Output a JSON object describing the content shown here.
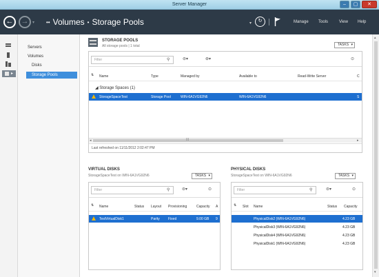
{
  "window": {
    "title": "Server Manager",
    "min": "‒",
    "max": "▢",
    "close": "✕"
  },
  "header": {
    "crumb_arrows": "••",
    "crumb_parent": "Volumes",
    "crumb_sep": "•",
    "crumb_current": "Storage Pools",
    "menu": [
      "Manage",
      "Tools",
      "View",
      "Help"
    ]
  },
  "nav": {
    "items": [
      "Servers",
      "Volumes",
      "Disks",
      "Storage Pools"
    ]
  },
  "storage_pools": {
    "title": "STORAGE POOLS",
    "subtitle": "All storage pools | 1 total",
    "tasks": "TASKS",
    "filter_placeholder": "Filter",
    "columns": [
      "Name",
      "Type",
      "Managed by",
      "Available to",
      "Read-Write Server",
      "C"
    ],
    "group": "Storage Spaces (1)",
    "rows": [
      {
        "name": "StorageSpaceTest",
        "type": "Storage Pool",
        "managed_by": "WIN-6A1VG92N6",
        "available_to": "WIN-6A1VG92N6",
        "rw_server": "",
        "c": "S"
      }
    ],
    "footer": "Last refreshed on 11/11/2012 2:02:47 PM"
  },
  "virtual_disks": {
    "title": "VIRTUAL DISKS",
    "subtitle": "StorageSpaceTest on WIN-6A1VG92N6",
    "tasks": "TASKS",
    "filter_placeholder": "Filter",
    "columns": [
      "Name",
      "Status",
      "Layout",
      "Provisioning",
      "Capacity",
      "A"
    ],
    "rows": [
      {
        "name": "TestVirtualDisk1",
        "status": "",
        "layout": "Parity",
        "provisioning": "Fixed",
        "capacity": "9.00 GB",
        "a": "9"
      }
    ]
  },
  "physical_disks": {
    "title": "PHYSICAL DISKS",
    "subtitle": "StorageSpaceTest on WIN-6A1VG92N6",
    "tasks": "TASKS",
    "filter_placeholder": "Filter",
    "columns": [
      "Slot",
      "Name",
      "Status",
      "Capacity"
    ],
    "rows": [
      {
        "name": "PhysicalDisk2 (WIN-6A1VG92N6)",
        "capacity": "4.23 GB"
      },
      {
        "name": "PhysicalDisk3 (WIN-6A1VG92N6)",
        "capacity": "4.23 GB"
      },
      {
        "name": "PhysicalDisk4 (WIN-6A1VG92N6)",
        "capacity": "4.23 GB"
      },
      {
        "name": "PhysicalDisk1 (WIN-6A1VG92N6)",
        "capacity": "4.23 GB"
      }
    ]
  }
}
